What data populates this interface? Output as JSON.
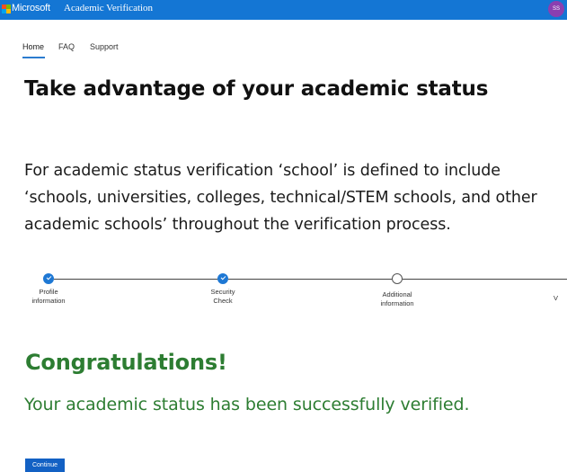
{
  "header": {
    "brand": "Microsoft",
    "app_title": "Academic Verification",
    "avatar_initials": "SS",
    "colors": {
      "bar": "#1476d4",
      "avatar": "#8b3fb0"
    }
  },
  "nav": {
    "tabs": [
      {
        "label": "Home",
        "active": true
      },
      {
        "label": "FAQ",
        "active": false
      },
      {
        "label": "Support",
        "active": false
      }
    ]
  },
  "main": {
    "title": "Take advantage of your academic status",
    "intro": "For academic status verification ‘school’ is defined to include ‘schools, universities, colleges, technical/STEM schools, and other academic schools’ throughout the verification process."
  },
  "stepper": {
    "steps": [
      {
        "label_line1": "Profile",
        "label_line2": "information",
        "status": "complete"
      },
      {
        "label_line1": "Security",
        "label_line2": "Check",
        "status": "complete"
      },
      {
        "label_line1": "Additional",
        "label_line2": "information",
        "status": "incomplete"
      },
      {
        "label_line1": "V",
        "label_line2": "",
        "status": "incomplete"
      }
    ]
  },
  "result": {
    "heading": "Congratulations!",
    "message": "Your academic status has been successfully verified.",
    "color": "#2d7d32"
  },
  "actions": {
    "continue_label": "Continue",
    "color": "#1361c4"
  }
}
